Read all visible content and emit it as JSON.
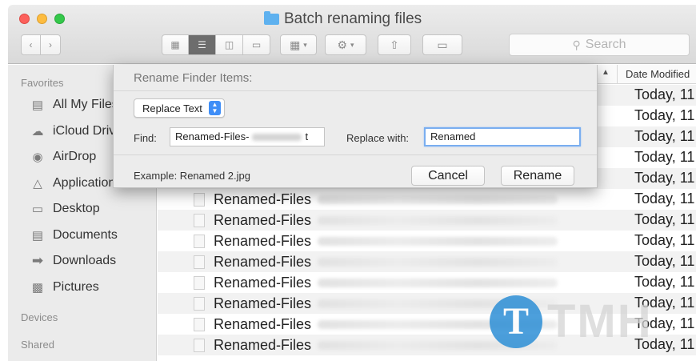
{
  "window": {
    "title": "Batch renaming files"
  },
  "toolbar": {
    "back_icon": "chevron-left-icon",
    "forward_icon": "chevron-right-icon",
    "search_placeholder": "Search"
  },
  "sidebar": {
    "favorites_label": "Favorites",
    "items": [
      {
        "label": "All My Files",
        "icon": "all-files-icon"
      },
      {
        "label": "iCloud Drive",
        "icon": "cloud-icon"
      },
      {
        "label": "AirDrop",
        "icon": "airdrop-icon"
      },
      {
        "label": "Applications",
        "icon": "applications-icon"
      },
      {
        "label": "Desktop",
        "icon": "desktop-icon"
      },
      {
        "label": "Documents",
        "icon": "documents-icon"
      },
      {
        "label": "Downloads",
        "icon": "downloads-icon"
      },
      {
        "label": "Pictures",
        "icon": "pictures-icon"
      }
    ],
    "devices_label": "Devices",
    "shared_label": "Shared"
  },
  "list": {
    "date_column": "Date Modified",
    "rows": [
      {
        "name": "",
        "date": "Today, 11"
      },
      {
        "name": "",
        "date": "Today, 11"
      },
      {
        "name": "",
        "date": "Today, 11"
      },
      {
        "name": "",
        "date": "Today, 11"
      },
      {
        "name": "",
        "date": "Today, 11"
      },
      {
        "name": "Renamed-Files",
        "date": "Today, 11"
      },
      {
        "name": "Renamed-Files",
        "date": "Today, 11"
      },
      {
        "name": "Renamed-Files",
        "date": "Today, 11"
      },
      {
        "name": "Renamed-Files",
        "date": "Today, 11"
      },
      {
        "name": "Renamed-Files",
        "date": "Today, 11"
      },
      {
        "name": "Renamed-Files",
        "date": "Today, 11"
      },
      {
        "name": "Renamed-Files",
        "date": "Today, 11"
      },
      {
        "name": "Renamed-Files",
        "date": "Today, 11"
      }
    ]
  },
  "dialog": {
    "title": "Rename Finder Items:",
    "mode": "Replace Text",
    "find_label": "Find:",
    "find_value_start": "Renamed-Files-",
    "find_value_end": "t",
    "replace_label": "Replace with:",
    "replace_value": "Renamed",
    "example": "Example: Renamed 2.jpg",
    "cancel_label": "Cancel",
    "rename_label": "Rename"
  },
  "watermark": {
    "glyph": "T",
    "text": "TMH"
  }
}
